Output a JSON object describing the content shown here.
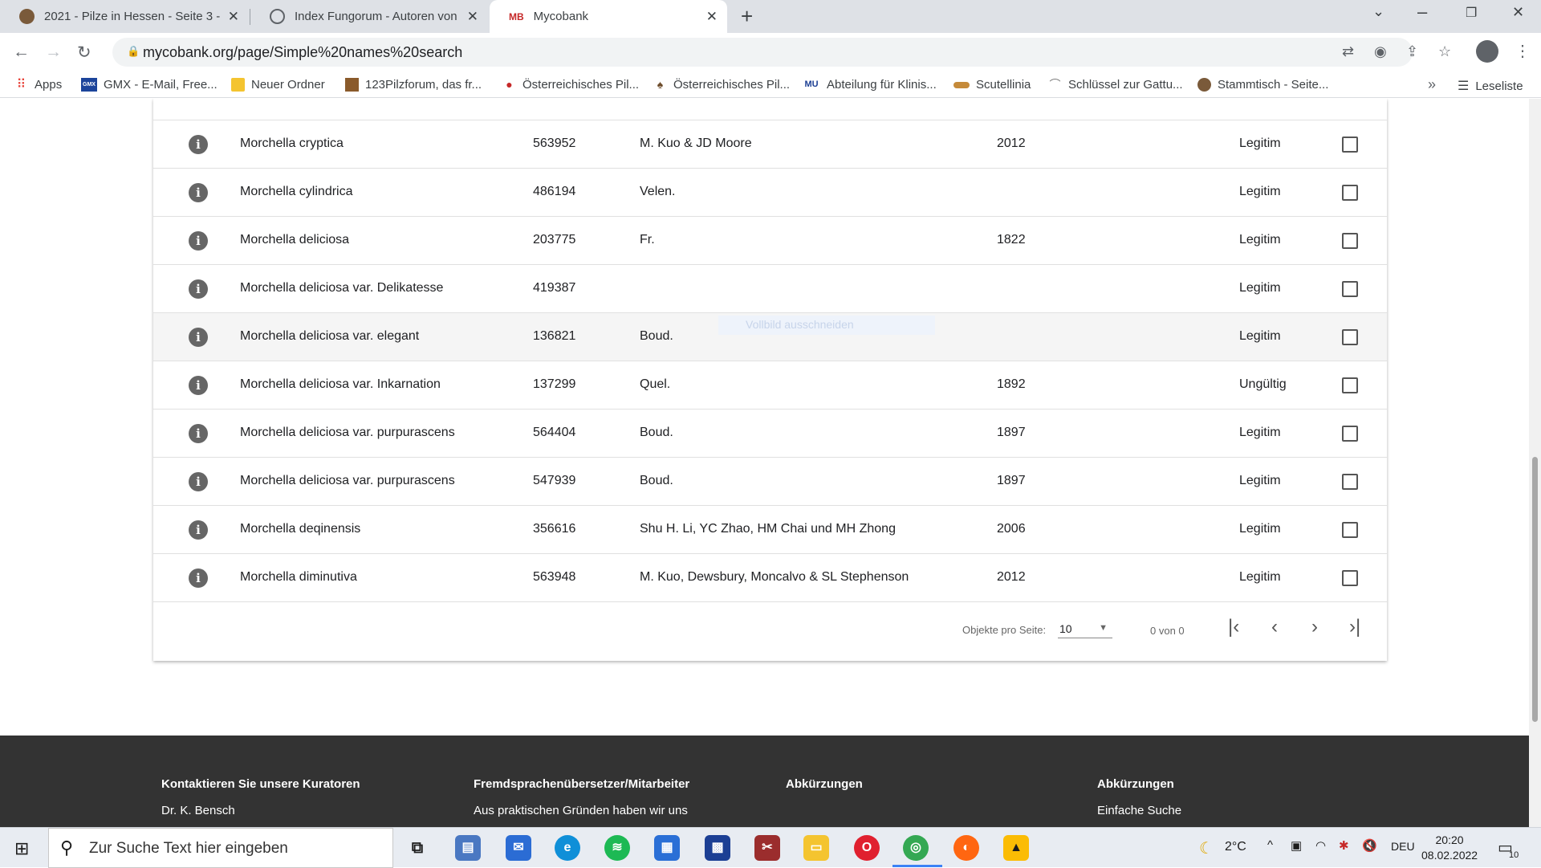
{
  "browser": {
    "tabs": [
      {
        "title": "2021 - Pilze in Hessen - Seite 3 -",
        "active": false
      },
      {
        "title": "Index Fungorum - Autoren von P",
        "active": false
      },
      {
        "title": "Mycobank",
        "active": true,
        "favicon_text": "MB"
      }
    ],
    "url": "mycobank.org/page/Simple%20names%20search",
    "bookmarks": [
      {
        "label": "Apps"
      },
      {
        "label": "GMX - E-Mail, Free...",
        "icon_text": "GMX"
      },
      {
        "label": "Neuer Ordner"
      },
      {
        "label": "123Pilzforum, das fr..."
      },
      {
        "label": "Österreichisches Pil..."
      },
      {
        "label": "Österreichisches Pil..."
      },
      {
        "label": "Abteilung für Klinis..."
      },
      {
        "label": "Scutellinia"
      },
      {
        "label": "Schlüssel zur Gattu..."
      },
      {
        "label": "Stammtisch - Seite..."
      }
    ],
    "reading_list_label": "Leseliste",
    "colors": {
      "tabbar": "#dee1e6",
      "omnibox": "#f1f3f4"
    }
  },
  "table": {
    "rows": [
      {
        "name": "Morchella cryptica",
        "number": "563952",
        "authors": "M. Kuo & JD Moore",
        "year": "2012",
        "status": "Legitim"
      },
      {
        "name": "Morchella cylindrica",
        "number": "486194",
        "authors": "Velen.",
        "year": "",
        "status": "Legitim"
      },
      {
        "name": "Morchella deliciosa",
        "number": "203775",
        "authors": "Fr.",
        "year": "1822",
        "status": "Legitim"
      },
      {
        "name": "Morchella deliciosa var. Delikatesse",
        "number": "419387",
        "authors": "",
        "year": "",
        "status": "Legitim"
      },
      {
        "name": "Morchella deliciosa var. elegant",
        "number": "136821",
        "authors": "Boud.",
        "year": "",
        "status": "Legitim"
      },
      {
        "name": "Morchella deliciosa var. Inkarnation",
        "number": "137299",
        "authors": "Quel.",
        "year": "1892",
        "status": "Ungültig"
      },
      {
        "name": "Morchella deliciosa var. purpurascens",
        "number": "564404",
        "authors": "Boud.",
        "year": "1897",
        "status": "Legitim"
      },
      {
        "name": "Morchella deliciosa var. purpurascens",
        "number": "547939",
        "authors": "Boud.",
        "year": "1897",
        "status": "Legitim"
      },
      {
        "name": "Morchella deqinensis",
        "number": "356616",
        "authors": "Shu H. Li, YC Zhao, HM Chai und MH Zhong",
        "year": "2006",
        "status": "Legitim"
      },
      {
        "name": "Morchella diminutiva",
        "number": "563948",
        "authors": "M. Kuo, Dewsbury, Moncalvo & SL Stephenson",
        "year": "2012",
        "status": "Legitim"
      }
    ]
  },
  "tooltip_text": "Vollbild ausschneiden",
  "paginator": {
    "per_page_label": "Objekte pro Seite:",
    "per_page_value": "10",
    "range_label": "0 von 0"
  },
  "footer": {
    "columns": [
      {
        "heading": "Kontaktieren Sie unsere Kuratoren",
        "text": "Dr. K. Bensch"
      },
      {
        "heading": "Fremdsprachenübersetzer/Mitarbeiter",
        "text": "Aus praktischen Gründen haben wir uns"
      },
      {
        "heading": "Abkürzungen",
        "text": ""
      },
      {
        "heading": "Abkürzungen",
        "text": "Einfache Suche"
      }
    ],
    "color": "#333333"
  },
  "taskbar": {
    "search_placeholder": "Zur Suche Text hier eingeben",
    "weather": "2°C",
    "language": "DEU",
    "time": "20:20",
    "date": "08.02.2022",
    "notification_count": "10"
  }
}
